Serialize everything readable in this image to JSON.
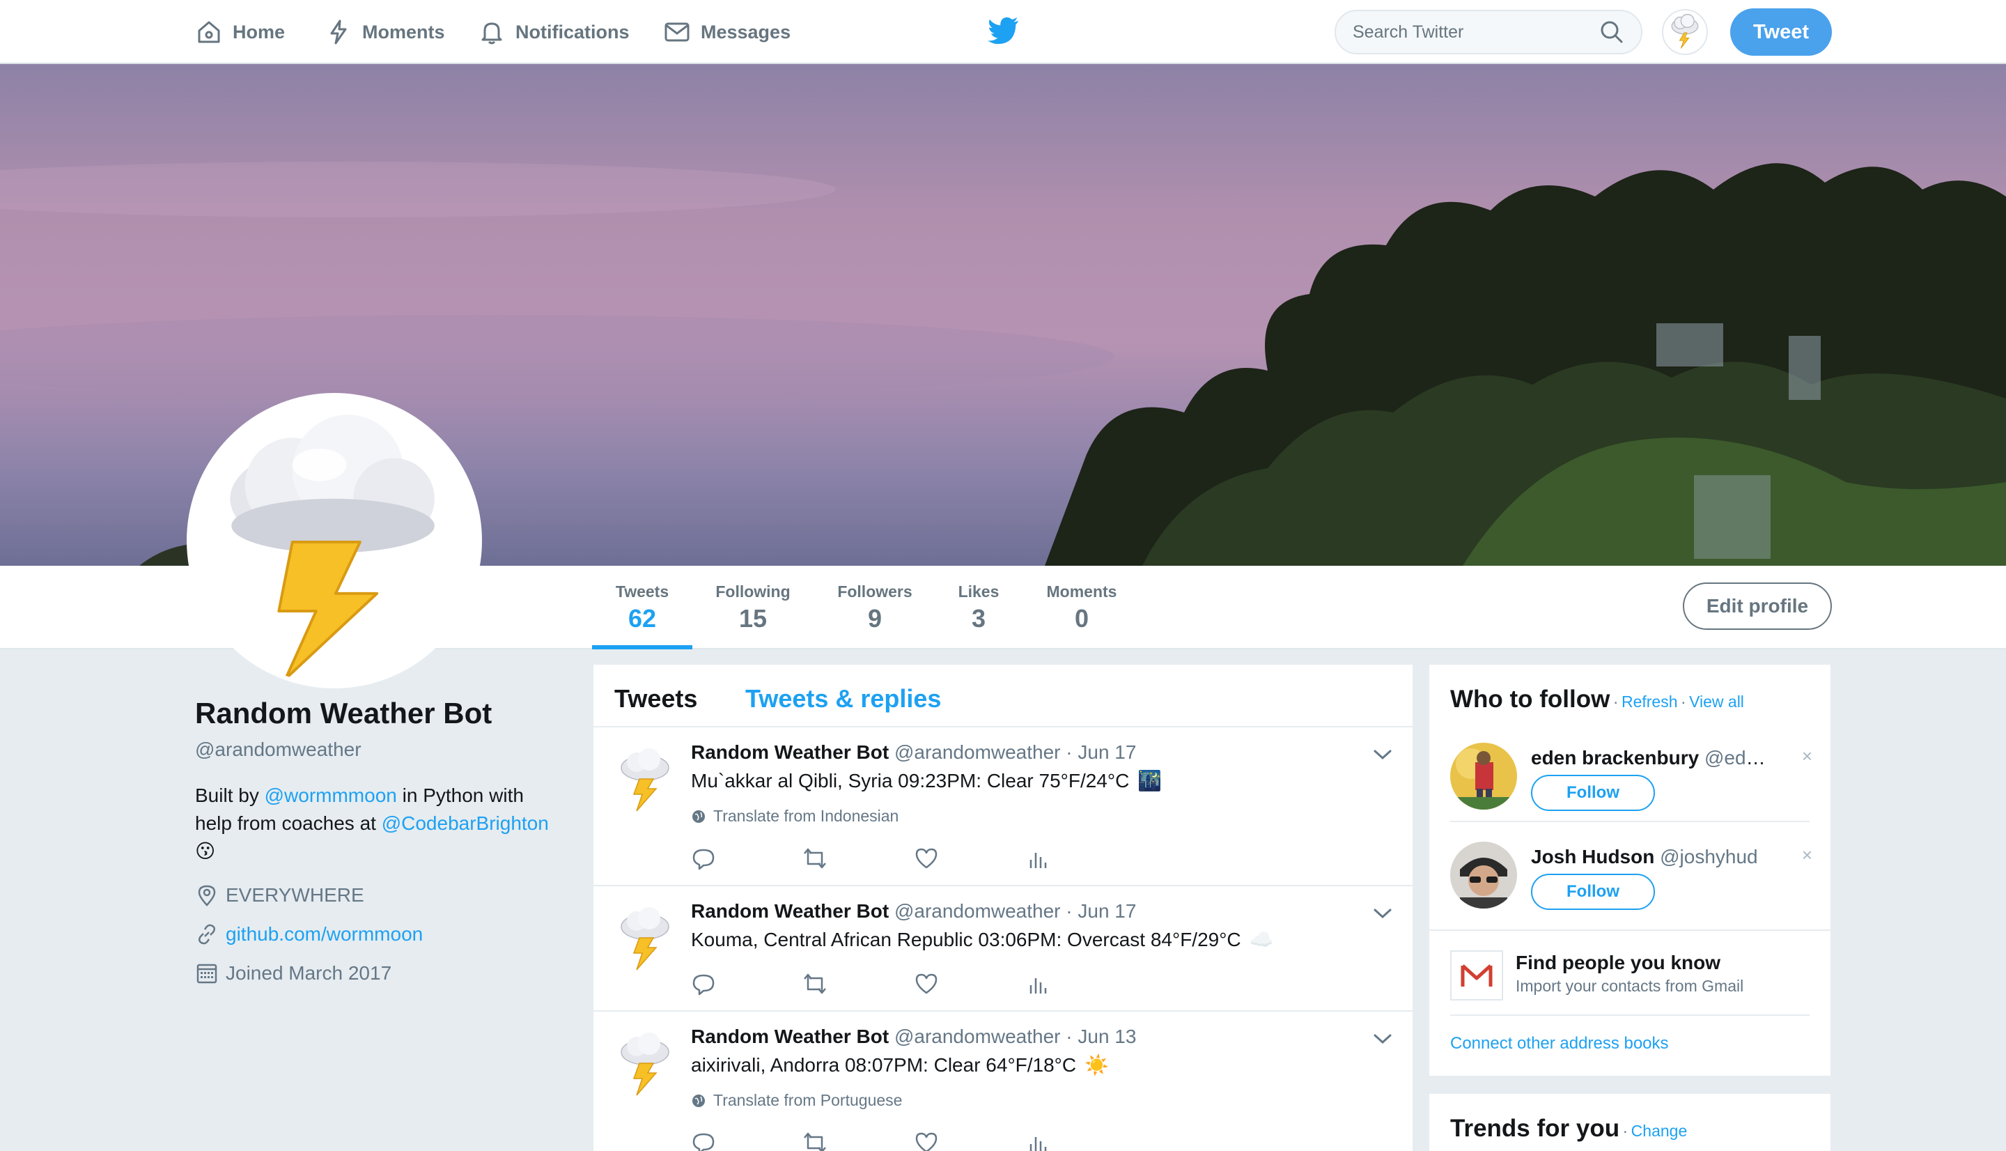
{
  "nav": {
    "home": "Home",
    "moments": "Moments",
    "notifications": "Notifications",
    "messages": "Messages",
    "search_placeholder": "Search Twitter",
    "tweet_button": "Tweet"
  },
  "colors": {
    "accent": "#1da1f2",
    "tweet_button": "#4aa1ec",
    "background": "#e6ecf0"
  },
  "profile_nav": {
    "stats": [
      {
        "label": "Tweets",
        "value": "62",
        "active": true
      },
      {
        "label": "Following",
        "value": "15"
      },
      {
        "label": "Followers",
        "value": "9"
      },
      {
        "label": "Likes",
        "value": "3"
      },
      {
        "label": "Moments",
        "value": "0"
      }
    ],
    "edit_button": "Edit profile"
  },
  "profile": {
    "name": "Random Weather Bot",
    "handle": "@arandomweather",
    "bio": {
      "part1": "Built by ",
      "mention1": "@wormmmoon",
      "part2": " in Python with help from coaches at ",
      "mention2": "@CodebarBrighton",
      "emoji": "😗"
    },
    "location": "EVERYWHERE",
    "website": "github.com/wormmoon",
    "joined": "Joined March 2017",
    "avatar_icon": "cloud-lightning-icon"
  },
  "timeline": {
    "tabs": [
      "Tweets",
      "Tweets & replies"
    ],
    "tweets": [
      {
        "name": "Random Weather Bot",
        "handle": "@arandomweather · Jun 17",
        "text": "Mu`akkar al Qibli, Syria 09:23PM: Clear 75°F/24°C",
        "emoji": "🌃",
        "translate": "Translate from Indonesian"
      },
      {
        "name": "Random Weather Bot",
        "handle": "@arandomweather · Jun 17",
        "text": "Kouma, Central African Republic 03:06PM: Overcast 84°F/29°C",
        "emoji": "☁️",
        "translate": ""
      },
      {
        "name": "Random Weather Bot",
        "handle": "@arandomweather · Jun 13",
        "text": "aixirivali, Andorra 08:07PM: Clear 64°F/18°C",
        "emoji": "☀️",
        "translate": "Translate from Portuguese"
      }
    ]
  },
  "who_to_follow": {
    "title": "Who to follow",
    "refresh": "Refresh",
    "view_all": "View all",
    "separator": "·",
    "users": [
      {
        "name": "eden brackenbury",
        "handle": "@ede…",
        "follow": "Follow",
        "dismiss": "×"
      },
      {
        "name": "Josh Hudson",
        "handle": "@joshyhud",
        "follow": "Follow",
        "dismiss": "×"
      }
    ],
    "find_people": "Find people you know",
    "import_contacts": "Import your contacts from Gmail",
    "connect_other": "Connect other address books"
  },
  "trends": {
    "title": "Trends for you",
    "change": "Change"
  }
}
